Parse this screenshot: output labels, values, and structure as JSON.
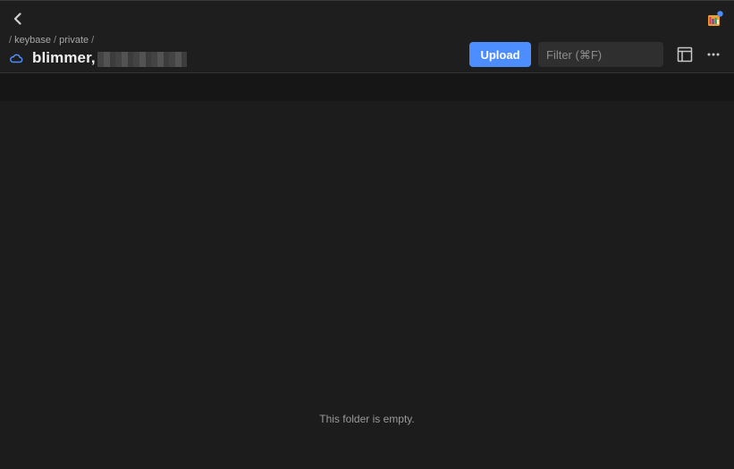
{
  "header": {
    "breadcrumb": [
      {
        "label": "keybase"
      },
      {
        "label": "private"
      }
    ],
    "breadcrumb_sep": "/",
    "folder_title": "blimmer,",
    "folder_title_redacted": true,
    "upload_label": "Upload",
    "filter_placeholder": "Filter (⌘F)",
    "filter_value": ""
  },
  "icons": {
    "back": "chevron-left-icon",
    "app": "keybase-app-icon",
    "cloud": "cloud-icon",
    "panel": "panel-toggle-icon",
    "more": "more-dots-icon"
  },
  "main": {
    "empty_message": "This folder is empty."
  },
  "colors": {
    "accent": "#4c8eff",
    "background": "#1c1c1c",
    "topbar": "#1e1e1e",
    "text_primary": "#f0f0f0",
    "text_muted": "#9a9a9a"
  }
}
